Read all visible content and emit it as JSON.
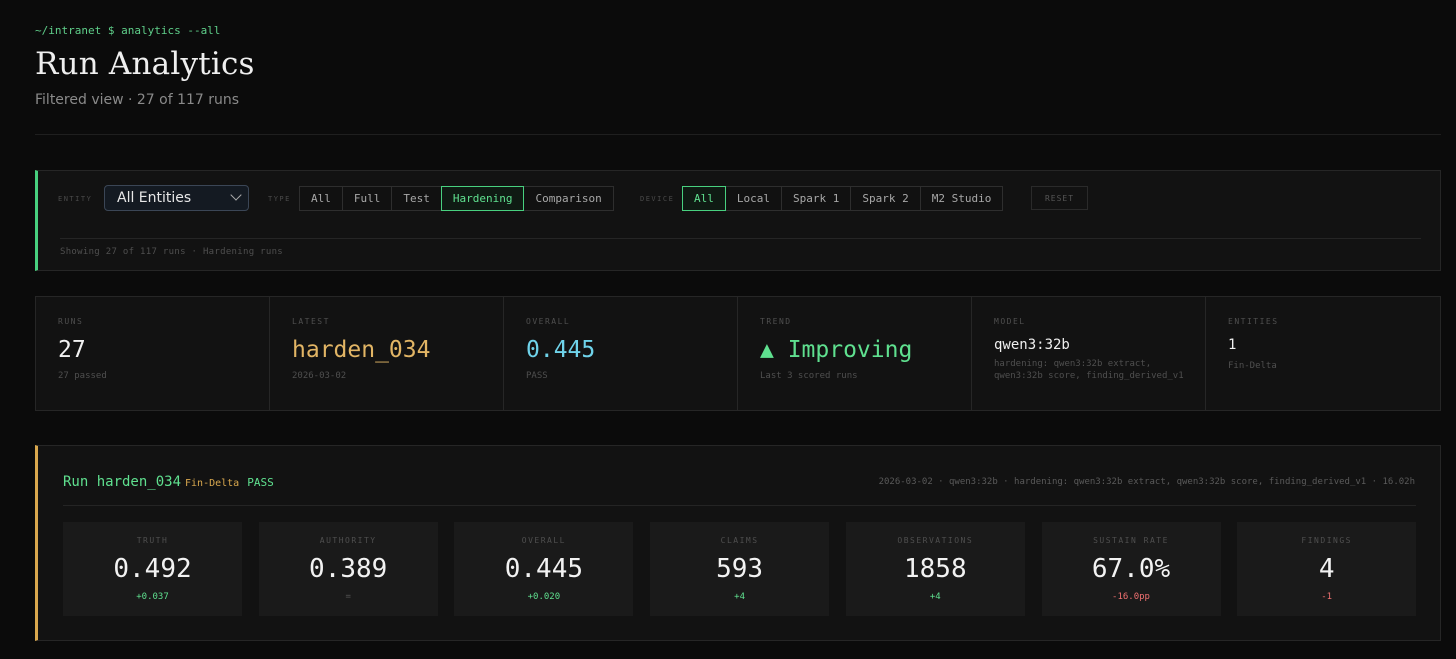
{
  "header": {
    "prompt": "~/intranet $ analytics --all",
    "title": "Run Analytics",
    "subtitle": "Filtered view · 27 of 117 runs"
  },
  "filters": {
    "entity_label": "ENTITY",
    "entity_value": "All Entities",
    "type_label": "TYPE",
    "type_options": [
      "All",
      "Full",
      "Test",
      "Hardening",
      "Comparison"
    ],
    "type_selected": "Hardening",
    "device_label": "DEVICE",
    "device_options": [
      "All",
      "Local",
      "Spark 1",
      "Spark 2",
      "M2 Studio"
    ],
    "device_selected": "All",
    "reset_label": "RESET",
    "showing": "Showing 27 of 117 runs · Hardening runs"
  },
  "stats": [
    {
      "label": "RUNS",
      "value": "27",
      "sub": "27 passed",
      "color": "#f0f0f0"
    },
    {
      "label": "LATEST",
      "value": "harden_034",
      "sub": "2026-03-02",
      "color": "#e2b565"
    },
    {
      "label": "OVERALL",
      "value": "0.445",
      "sub": "PASS",
      "color": "#6fd3ea"
    },
    {
      "label": "TREND",
      "value": "▲ Improving",
      "sub": "Last 3 scored runs",
      "color": "#5fe08f"
    },
    {
      "label": "MODEL",
      "value": "qwen3:32b",
      "sub": "hardening: qwen3:32b extract, qwen3:32b score, finding_derived_v1",
      "color": "#f0f0f0"
    },
    {
      "label": "ENTITIES",
      "value": "1",
      "sub": "Fin-Delta",
      "color": "#f0f0f0"
    }
  ],
  "run": {
    "title": "Run harden_034",
    "entity": "Fin-Delta",
    "status": "PASS",
    "meta": "2026-03-02 · qwen3:32b · hardening: qwen3:32b extract, qwen3:32b score, finding_derived_v1 · 16.02h",
    "metrics": [
      {
        "label": "TRUTH",
        "value": "0.492",
        "delta": "+0.037",
        "trend": "pos"
      },
      {
        "label": "AUTHORITY",
        "value": "0.389",
        "delta": "=",
        "trend": "neu"
      },
      {
        "label": "OVERALL",
        "value": "0.445",
        "delta": "+0.020",
        "trend": "pos"
      },
      {
        "label": "CLAIMS",
        "value": "593",
        "delta": "+4",
        "trend": "pos"
      },
      {
        "label": "OBSERVATIONS",
        "value": "1858",
        "delta": "+4",
        "trend": "pos"
      },
      {
        "label": "SUSTAIN RATE",
        "value": "67.0%",
        "delta": "-16.0pp",
        "trend": "neg"
      },
      {
        "label": "FINDINGS",
        "value": "4",
        "delta": "-1",
        "trend": "neg"
      }
    ]
  }
}
